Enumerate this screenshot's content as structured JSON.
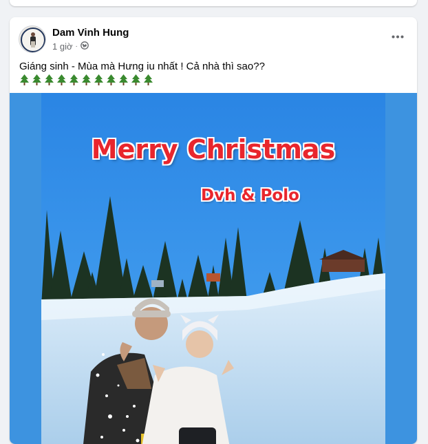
{
  "post": {
    "author": "Dam Vinh Hung",
    "time": "1 giờ",
    "privacy_icon": "globe-icon",
    "more_icon": "more-options-icon",
    "caption": "Giáng sinh - Mùa mà Hưng iu nhất ! Cả nhà thì sao??",
    "tree_emoji": "🌲",
    "tree_count": 11
  },
  "photo": {
    "title_text": "Merry Christmas",
    "subtitle_text": "Dvh & Polo",
    "sky_color": "#2f8be6",
    "frame_color": "#3d93e0",
    "text_color": "#e8262d"
  }
}
